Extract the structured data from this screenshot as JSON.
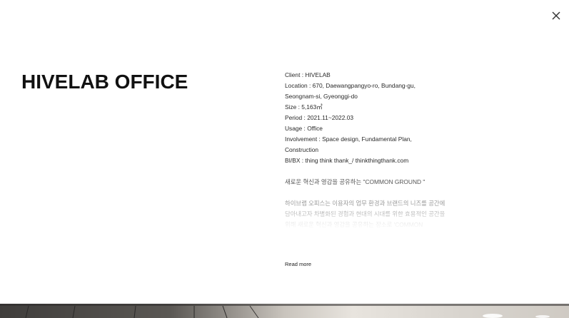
{
  "close": {
    "icon": "close-icon"
  },
  "project": {
    "title": "HIVELAB OFFICE"
  },
  "info": {
    "client": "Client : HIVELAB",
    "location_1": "Location : 670, Daewangpangyo-ro, Bundang-gu,",
    "location_2": "Seongnam-si, Gyeonggi-do",
    "size": "Size : 5,163㎡",
    "period": "Period : 2021.11~2022.03",
    "usage": "Usage : Office",
    "involvement_1": "Involvement : Space design, Fundamental Plan,",
    "involvement_2": "Construction",
    "bibx": "BI/BX : thing think thank_/ thinkthingthank.com"
  },
  "tagline": "새로운 혁신과 영감을 공유하는 \"COMMON GROUND \"",
  "description": {
    "line_1": "하이브랩 오피스는 이용자의 업무 환경과 브랜드의 니즈를 공간에",
    "line_2": "담아내고자 차별화된 경험과 현대의 시대를 위한 효용적인 공간을",
    "line_3": "위해 새로운 혁신과 영감을 공유하는 장소로 'COMMON"
  },
  "read_more": "Read more",
  "colors": {
    "text_primary": "#111111",
    "text_body": "#2a2a2a",
    "text_muted": "#9a9a9a",
    "background": "#ffffff"
  }
}
